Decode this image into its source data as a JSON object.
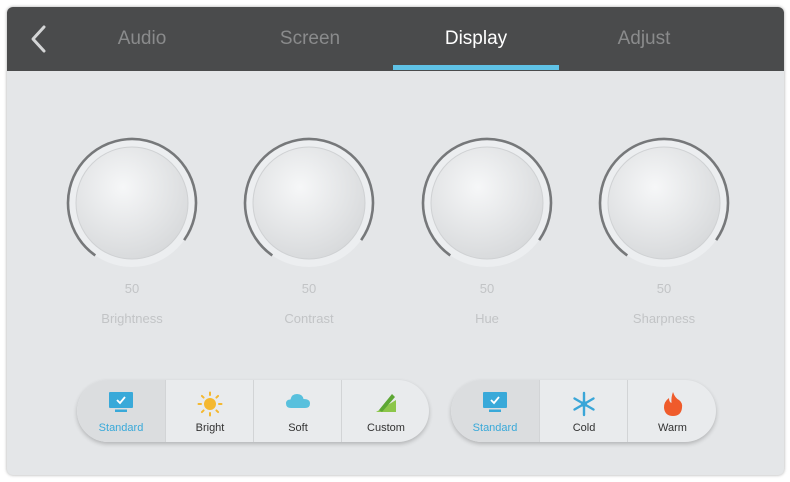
{
  "tabs": [
    {
      "label": "Audio",
      "active": false
    },
    {
      "label": "Screen",
      "active": false
    },
    {
      "label": "Display",
      "active": true
    },
    {
      "label": "Adjust",
      "active": false
    }
  ],
  "knobs": [
    {
      "value": "50",
      "label": "Brightness"
    },
    {
      "value": "50",
      "label": "Contrast"
    },
    {
      "value": "50",
      "label": "Hue"
    },
    {
      "value": "50",
      "label": "Sharpness"
    }
  ],
  "picture_modes": {
    "selected": "Standard",
    "items": [
      {
        "label": "Standard",
        "icon": "monitor-check-icon"
      },
      {
        "label": "Bright",
        "icon": "sun-icon"
      },
      {
        "label": "Soft",
        "icon": "cloud-icon"
      },
      {
        "label": "Custom",
        "icon": "pencil-icon"
      }
    ]
  },
  "color_temperature": {
    "selected": "Standard",
    "items": [
      {
        "label": "Standard",
        "icon": "monitor-check-icon"
      },
      {
        "label": "Cold",
        "icon": "snowflake-icon"
      },
      {
        "label": "Warm",
        "icon": "flame-icon"
      }
    ]
  },
  "colors": {
    "accent": "#5fc2e6",
    "topbar": "#4a4b4c",
    "panel": "#e4e6e8"
  }
}
